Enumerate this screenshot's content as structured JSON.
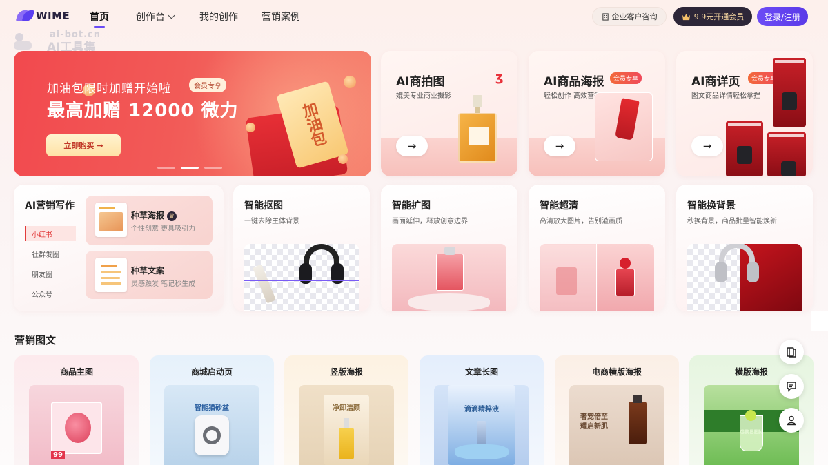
{
  "brand": {
    "name": "WIME"
  },
  "watermark": {
    "line1": "ai-bot.cn",
    "line2": "AI工具集"
  },
  "nav": {
    "home": "首页",
    "create": "创作台",
    "mine": "我的创作",
    "cases": "营销案例"
  },
  "header_actions": {
    "consult": "企业客户咨询",
    "vip": "9.9元开通会员",
    "login": "登录/注册"
  },
  "banner": {
    "line1": "加油包限时加赠开始啦",
    "badge": "会员专享",
    "line2": "最高加赠 12000 微力",
    "cta": "立即购买",
    "ticket_text": "加油包",
    "active_slide": 2,
    "slides": 3
  },
  "product_cards": [
    {
      "title": "AI商拍图",
      "subtitle": "媲美专业商业摄影"
    },
    {
      "title": "AI商品海报",
      "subtitle": "轻松创作 高效营销",
      "badge": "会员专享"
    },
    {
      "title": "AI商详页",
      "subtitle": "图文商品详情轻松拿捏",
      "badge": "会员专享"
    }
  ],
  "writing": {
    "title": "AI营销写作",
    "tabs": [
      "小红书",
      "社群发圈",
      "朋友圈",
      "公众号"
    ],
    "active_tab": 0,
    "items": [
      {
        "title": "种草海报",
        "desc": "个性创意 更具吸引力",
        "vip": true
      },
      {
        "title": "种草文案",
        "desc": "灵感触发 笔记秒生成",
        "vip": false
      }
    ]
  },
  "tools": [
    {
      "title": "智能抠图",
      "desc": "一键去除主体背景"
    },
    {
      "title": "智能扩图",
      "desc": "画面延伸，释放创意边界"
    },
    {
      "title": "智能超清",
      "desc": "高清放大图片，告别渣画质"
    },
    {
      "title": "智能换背景",
      "desc": "秒换背景，商品批量智能焕新"
    }
  ],
  "section": {
    "title": "营销图文"
  },
  "marketing_cards": [
    {
      "title": "商品主图",
      "image_text": "99"
    },
    {
      "title": "商城启动页",
      "image_text": "智能猫砂盆"
    },
    {
      "title": "竖版海报",
      "image_text": "净卸洁颜"
    },
    {
      "title": "文章长图",
      "image_text": "滴滴精粹液"
    },
    {
      "title": "电商横版海报",
      "image_text": "奢宠倍至 耀启新肌"
    },
    {
      "title": "横版海报",
      "image_text": "GREEN"
    }
  ],
  "side_tools": [
    "book-icon",
    "chat-icon",
    "user-icon"
  ],
  "colors": {
    "accent": "#6a4cf5",
    "banner": "#f2494e",
    "active_tab": "#e23b3b"
  }
}
